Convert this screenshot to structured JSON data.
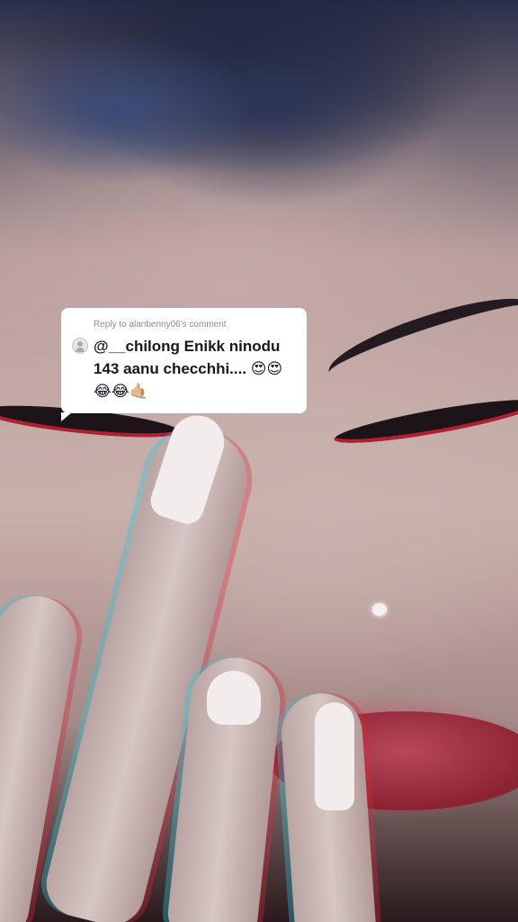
{
  "reply_card": {
    "header": "Reply to alanbenny06's comment",
    "avatar_icon": "default-avatar-icon",
    "comment_text": "@__chilong Enikk ninodu 143 aanu checchhi.... 😍😍😂😂🤙🏼"
  },
  "colors": {
    "card_background": "#ffffff",
    "header_text": "#8a8b91",
    "comment_text": "#161823"
  }
}
